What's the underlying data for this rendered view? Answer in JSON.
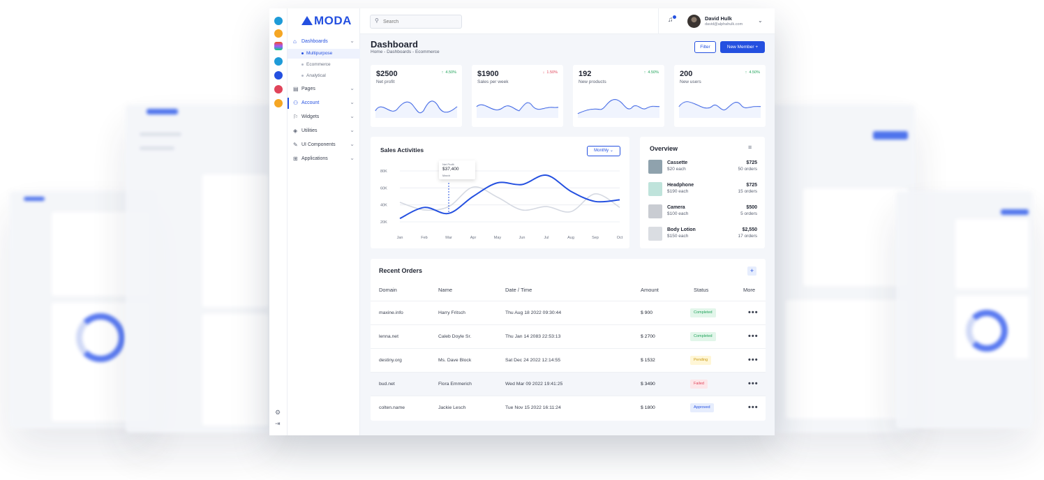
{
  "brand": {
    "name": "MODA",
    "accent": "#2450e0"
  },
  "rail_icons": [
    "tool-icon",
    "sketch-icon",
    "figma-icon",
    "chart-app-icon",
    "discord-icon",
    "invision-icon",
    "paper-plane-icon"
  ],
  "sidebar": {
    "items": [
      {
        "label": "Dashboards",
        "icon": "home-icon"
      },
      {
        "label": "Pages",
        "icon": "page-icon"
      },
      {
        "label": "Account",
        "icon": "user-icon"
      },
      {
        "label": "Widgets",
        "icon": "bookmark-icon"
      },
      {
        "label": "Utilities",
        "icon": "layers-icon"
      },
      {
        "label": "UI Components",
        "icon": "brush-icon"
      },
      {
        "label": "Applications",
        "icon": "apps-icon"
      }
    ],
    "subitems": [
      "Multipurpose",
      "Ecommerce",
      "Analytical"
    ]
  },
  "search": {
    "placeholder": "Search"
  },
  "user": {
    "name": "David Hulk",
    "email": "david@alphahulk.com"
  },
  "header": {
    "title": "Dashboard",
    "breadcrumb": "Home - Dashboards - Ecommerce",
    "filter_label": "Filter",
    "new_member_label": "New Member +"
  },
  "kpis": [
    {
      "value": "$2500",
      "label": "Net profit",
      "change": "4.50%",
      "direction": "up"
    },
    {
      "value": "$1900",
      "label": "Sales per week",
      "change": "1.50%",
      "direction": "down"
    },
    {
      "value": "192",
      "label": "New products",
      "change": "4.50%",
      "direction": "up"
    },
    {
      "value": "200",
      "label": "New users",
      "change": "4.50%",
      "direction": "up"
    }
  ],
  "sales": {
    "title": "Sales Activities",
    "period_label": "Monthly",
    "tooltip": {
      "title": "Net Profit",
      "value": "$37,400",
      "month": "March"
    }
  },
  "chart_data": {
    "type": "line",
    "categories": [
      "Jan",
      "Feb",
      "Mar",
      "Apr",
      "May",
      "Jun",
      "Jul",
      "Aug",
      "Sep",
      "Oct"
    ],
    "y_ticks": [
      "80K",
      "60K",
      "40K",
      "20K"
    ],
    "ylim": [
      20000,
      80000
    ],
    "grid": true,
    "series": [
      {
        "color": "#2450e0",
        "values": [
          24000,
          37000,
          30000,
          50000,
          66000,
          64000,
          75000,
          56000,
          44000,
          46000
        ]
      },
      {
        "color": "#d5d9e2",
        "values": [
          43000,
          34000,
          38000,
          61000,
          49000,
          34000,
          38000,
          32000,
          53000,
          37000
        ]
      }
    ]
  },
  "overview": {
    "title": "Overview",
    "items": [
      {
        "name": "Cassette",
        "price": "$20 each",
        "amount": "$725",
        "orders": "50 orders",
        "color": "#8fa2ad"
      },
      {
        "name": "Headphone",
        "price": "$190 each",
        "amount": "$725",
        "orders": "15 orders",
        "color": "#bfe3db"
      },
      {
        "name": "Camera",
        "price": "$100 each",
        "amount": "$500",
        "orders": "5 orders",
        "color": "#c9ccd2"
      },
      {
        "name": "Body Lotion",
        "price": "$150 each",
        "amount": "$2,550",
        "orders": "17 orders",
        "color": "#dadde2"
      }
    ]
  },
  "orders": {
    "title": "Recent Orders",
    "columns": [
      "Domain",
      "Name",
      "Date / Time",
      "Amount",
      "Status",
      "More"
    ],
    "rows": [
      {
        "domain": "maxine.info",
        "name": "Harry Fritsch",
        "date": "Thu Aug 18 2022 09:30:44",
        "amount": "$ 900",
        "status": "Completed"
      },
      {
        "domain": "lenna.net",
        "name": "Caleb Doyle Sr.",
        "date": "Thu Jan 14 2083 22:53:13",
        "amount": "$ 2700",
        "status": "Completed"
      },
      {
        "domain": "destiny.org",
        "name": "Ms. Dave Block",
        "date": "Sat Dec 24 2022 12:14:55",
        "amount": "$ 1532",
        "status": "Pending"
      },
      {
        "domain": "bud.net",
        "name": "Flora Emmerich",
        "date": "Wed Mar 09 2022 19:41:25",
        "amount": "$ 3490",
        "status": "Failed"
      },
      {
        "domain": "colten.name",
        "name": "Jackie Lesch",
        "date": "Tue Nov 15 2022 16:11:24",
        "amount": "$ 1800",
        "status": "Approved"
      }
    ]
  }
}
